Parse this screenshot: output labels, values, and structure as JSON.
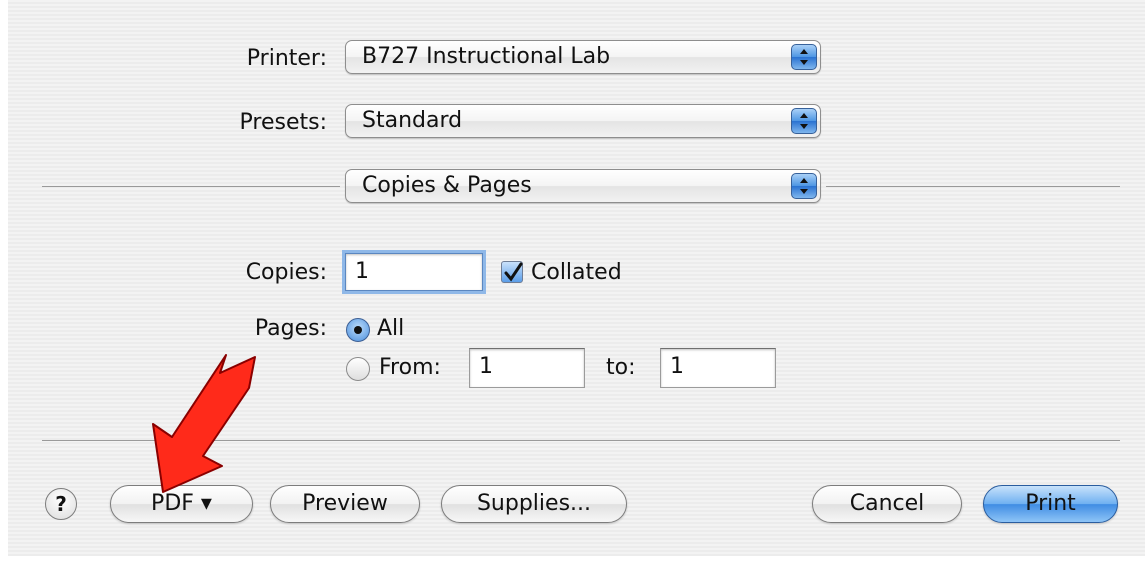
{
  "printer": {
    "label": "Printer:",
    "value": "B727 Instructional Lab"
  },
  "presets": {
    "label": "Presets:",
    "value": "Standard"
  },
  "section": {
    "value": "Copies & Pages"
  },
  "copies": {
    "label": "Copies:",
    "value": "1",
    "collated_label": "Collated",
    "collated_checked": true
  },
  "pages": {
    "label": "Pages:",
    "all_label": "All",
    "from_label": "From:",
    "from_value": "1",
    "to_label": "to:",
    "to_value": "1",
    "selected": "All"
  },
  "buttons": {
    "help": "?",
    "pdf": "PDF ▾",
    "preview": "Preview",
    "supplies": "Supplies...",
    "cancel": "Cancel",
    "print": "Print"
  },
  "annotation": {
    "color": "#ff2a1a",
    "icon": "red-arrow-pointing-to-pdf"
  }
}
